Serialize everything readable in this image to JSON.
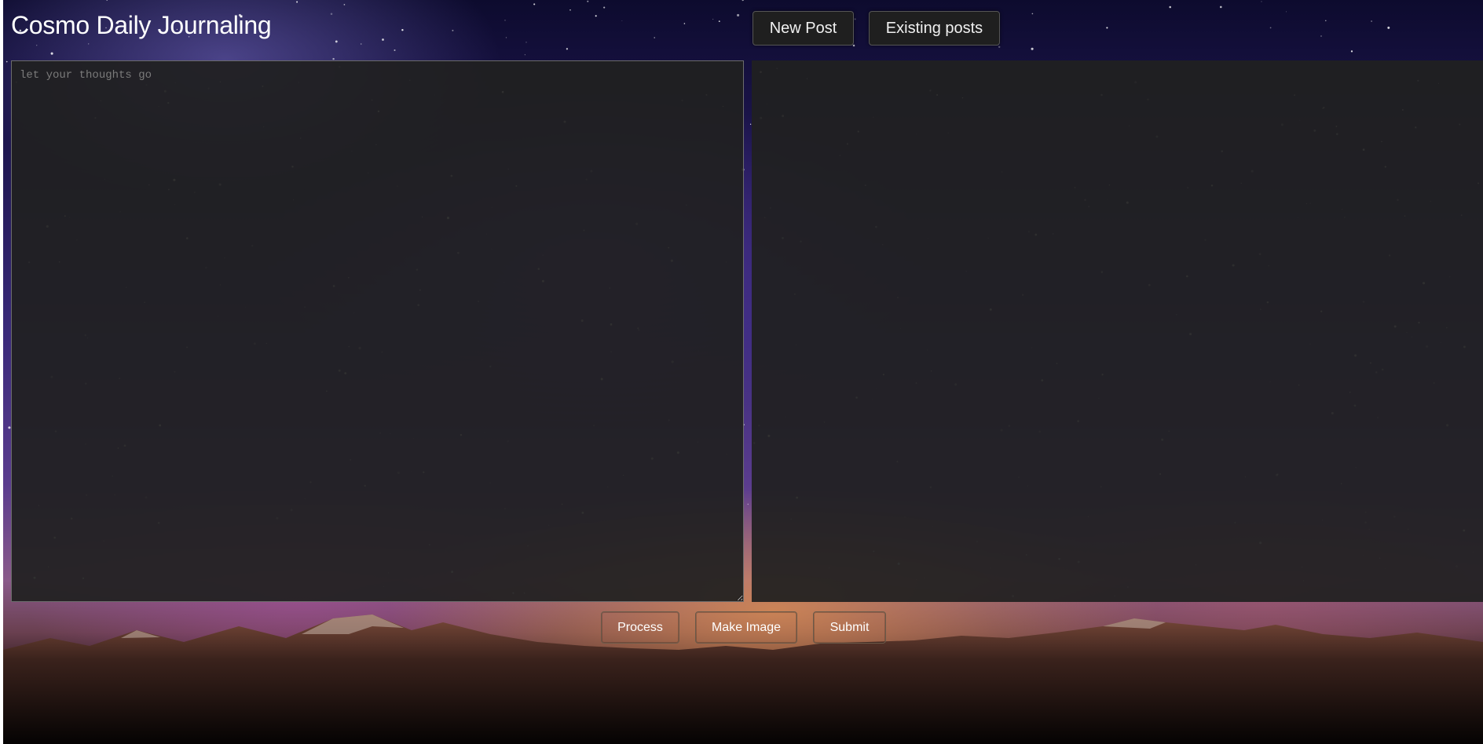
{
  "header": {
    "title": "Cosmo Daily Journaling",
    "nav": {
      "new_post_label": "New Post",
      "existing_posts_label": "Existing posts"
    }
  },
  "editor": {
    "placeholder": "let your thoughts go",
    "value": ""
  },
  "actions": {
    "process_label": "Process",
    "make_image_label": "Make Image",
    "submit_label": "Submit"
  }
}
